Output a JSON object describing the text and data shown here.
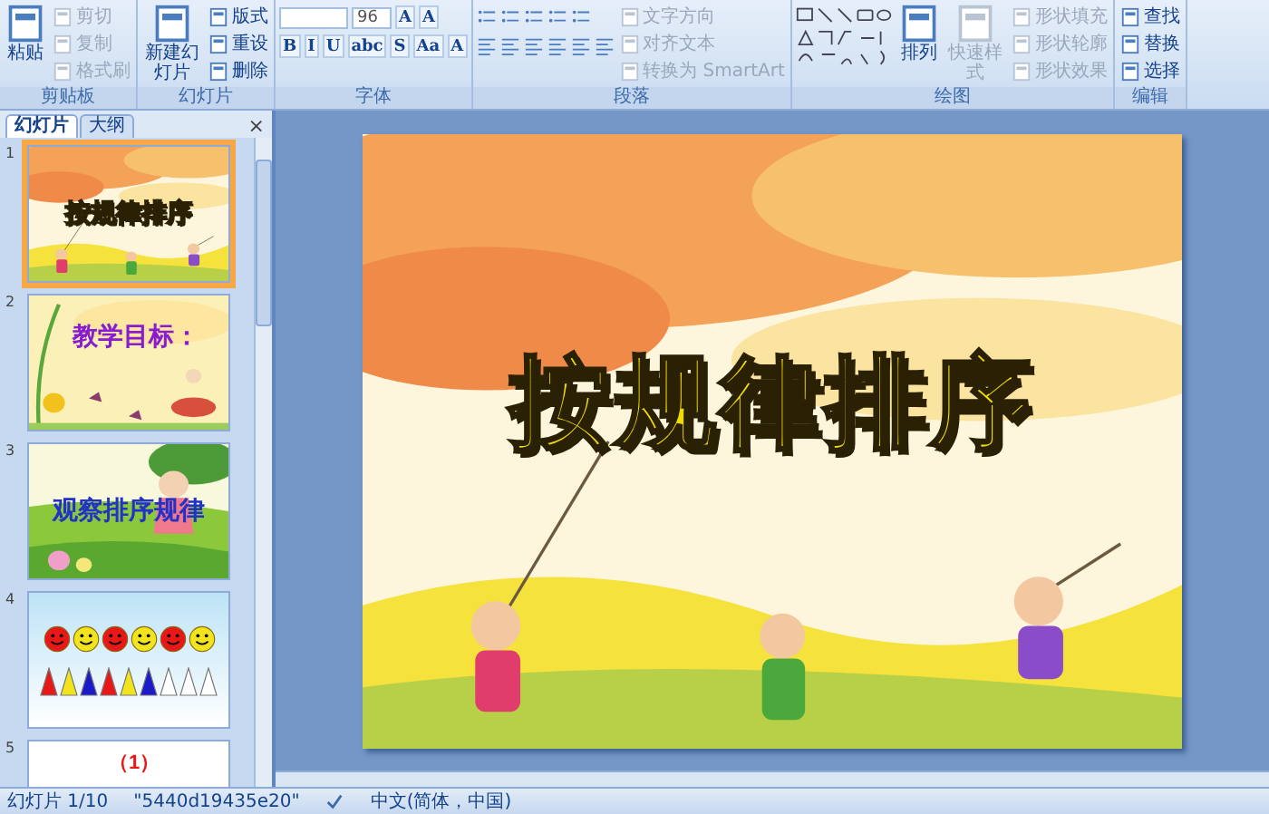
{
  "ribbon": {
    "groups": [
      {
        "kind": "commands",
        "label": "剪贴板",
        "items": [
          {
            "label": "粘贴",
            "kind": "large",
            "disabled": false
          },
          {
            "label": "剪切",
            "kind": "small",
            "disabled": true
          },
          {
            "label": "复制",
            "kind": "small",
            "disabled": true
          },
          {
            "label": "格式刷",
            "kind": "small",
            "disabled": true
          }
        ]
      },
      {
        "kind": "commands",
        "label": "幻灯片",
        "items": [
          {
            "label": "新建幻灯片",
            "kind": "large",
            "disabled": false
          },
          {
            "label": "版式",
            "kind": "small",
            "disabled": false
          },
          {
            "label": "重设",
            "kind": "small",
            "disabled": false
          },
          {
            "label": "删除",
            "kind": "small",
            "disabled": false
          }
        ]
      },
      {
        "kind": "font",
        "label": "字体",
        "font_size": "96",
        "size_buttons": [
          "A",
          "A"
        ],
        "format_buttons": [
          "B",
          "I",
          "U",
          "abc",
          "S",
          "Aa",
          "A"
        ]
      },
      {
        "kind": "paragraph",
        "label": "段落",
        "items": [
          {
            "label": "文字方向",
            "kind": "small",
            "disabled": true
          },
          {
            "label": "对齐文本",
            "kind": "small",
            "disabled": true
          },
          {
            "label": "转换为 SmartArt",
            "kind": "small",
            "disabled": true
          }
        ]
      },
      {
        "kind": "drawing",
        "label": "绘图",
        "items": [
          {
            "label": "排列",
            "kind": "large",
            "disabled": false
          },
          {
            "label": "快速样式",
            "kind": "large",
            "disabled": true
          },
          {
            "label": "形状填充",
            "kind": "small",
            "disabled": true
          },
          {
            "label": "形状轮廓",
            "kind": "small",
            "disabled": true
          },
          {
            "label": "形状效果",
            "kind": "small",
            "disabled": true
          }
        ]
      },
      {
        "kind": "commands",
        "label": "编辑",
        "items": [
          {
            "label": "查找",
            "kind": "small",
            "disabled": false
          },
          {
            "label": "替换",
            "kind": "small",
            "disabled": false
          },
          {
            "label": "选择",
            "kind": "small",
            "disabled": false
          }
        ]
      }
    ]
  },
  "panel": {
    "tabs": [
      {
        "label": "幻灯片",
        "selected": true
      },
      {
        "label": "大纲",
        "selected": false
      }
    ],
    "close": "×"
  },
  "slides": [
    {
      "number": "1",
      "selected": true,
      "kind": "title",
      "title": "按规律排序"
    },
    {
      "number": "2",
      "selected": false,
      "kind": "title",
      "title": "教学目标："
    },
    {
      "number": "3",
      "selected": false,
      "kind": "title",
      "title": "观察排序规律"
    },
    {
      "number": "4",
      "selected": false,
      "kind": "shapes",
      "faces": [
        {
          "color": "#e81818"
        },
        {
          "color": "#f2e41c"
        },
        {
          "color": "#e81818"
        },
        {
          "color": "#f2e41c"
        },
        {
          "color": "#e81818"
        },
        {
          "color": "#f2e41c"
        }
      ],
      "triangles": [
        {
          "color": "#e81818"
        },
        {
          "color": "#f2e41c"
        },
        {
          "color": "#1a1ac8"
        },
        {
          "color": "#e81818"
        },
        {
          "color": "#f2e41c"
        },
        {
          "color": "#1a1ac8"
        },
        {
          "color": "#ffffff"
        },
        {
          "color": "#ffffff"
        },
        {
          "color": "#ffffff"
        }
      ]
    },
    {
      "number": "5",
      "selected": false,
      "kind": "title",
      "title": "（1）"
    }
  ],
  "current_slide": {
    "title": "按规律排序"
  },
  "status_bar": {
    "position": "幻灯片 1/10",
    "theme": "\"5440d19435e20\"",
    "language": "中文(简体，中国)"
  }
}
